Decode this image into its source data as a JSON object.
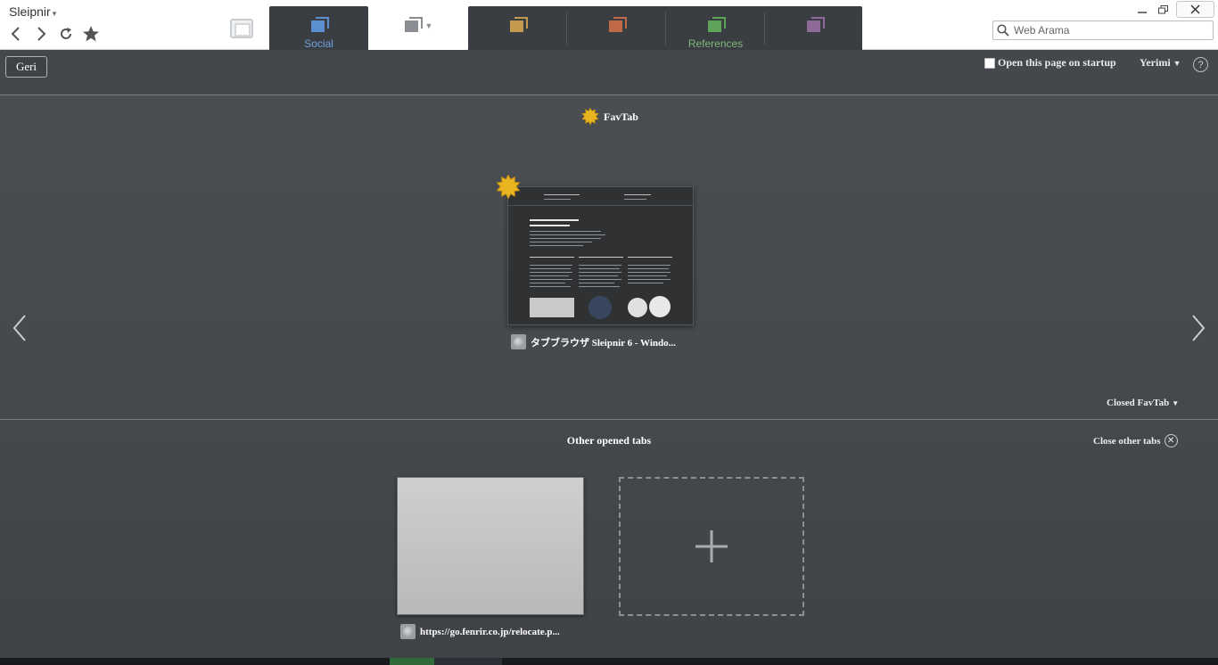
{
  "browser": {
    "brand": "Sleipnir",
    "brand_caret": "▾",
    "search_placeholder": "Web Arama"
  },
  "group_tabs": [
    {
      "label": "Social",
      "color": "#5b8fd0"
    },
    {
      "label": "",
      "color": "#8a8d91"
    },
    {
      "label": "",
      "color": "#c49a4e"
    },
    {
      "label": "",
      "color": "#c06a4a"
    },
    {
      "label": "References",
      "color": "#5fa35a"
    },
    {
      "label": "",
      "color": "#8e6a99"
    }
  ],
  "toolbar": {
    "back_label": "Geri",
    "open_on_startup": "Open this page on startup",
    "user": "Yerimi",
    "help": "?"
  },
  "favtab": {
    "title": "FavTab",
    "items": [
      {
        "title": "タブブラウザ Sleipnir 6 - Windo..."
      }
    ],
    "closed_label": "Closed FavTab"
  },
  "other_tabs": {
    "title": "Other opened tabs",
    "close_label": "Close other tabs",
    "items": [
      {
        "title": "https://go.fenrir.co.jp/relocate.p..."
      }
    ],
    "new_tab_symbol": "+"
  },
  "colors": {
    "background": "#44474b",
    "accent_social": "#5b8fd0",
    "accent_references": "#5fa35a",
    "favtab_sun": "#e8b521"
  }
}
